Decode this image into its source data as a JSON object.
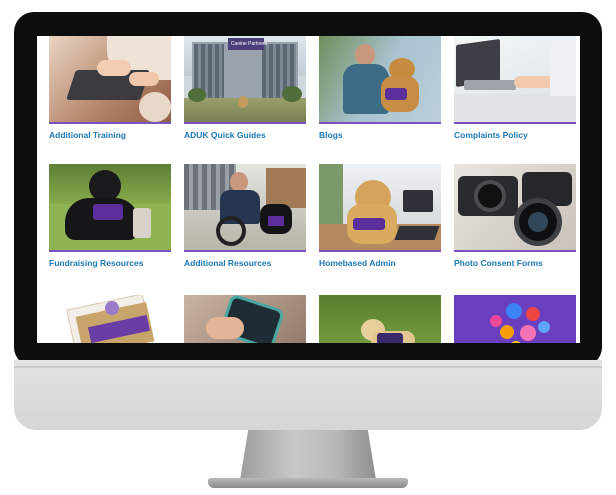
{
  "theme": {
    "accent": "#7b53c1",
    "label_color": "#1c79b5"
  },
  "cards": [
    {
      "label": "Additional Training"
    },
    {
      "label": "ADUK Quick Guides"
    },
    {
      "label": "Blogs"
    },
    {
      "label": "Complaints Policy"
    },
    {
      "label": "Fundraising Resources"
    },
    {
      "label": "Additional Resources"
    },
    {
      "label": "Homebased Admin"
    },
    {
      "label": "Photo Consent Forms"
    },
    {
      "label": ""
    },
    {
      "label": ""
    },
    {
      "label": ""
    },
    {
      "label": ""
    }
  ],
  "building_sign": "Canine Partners"
}
